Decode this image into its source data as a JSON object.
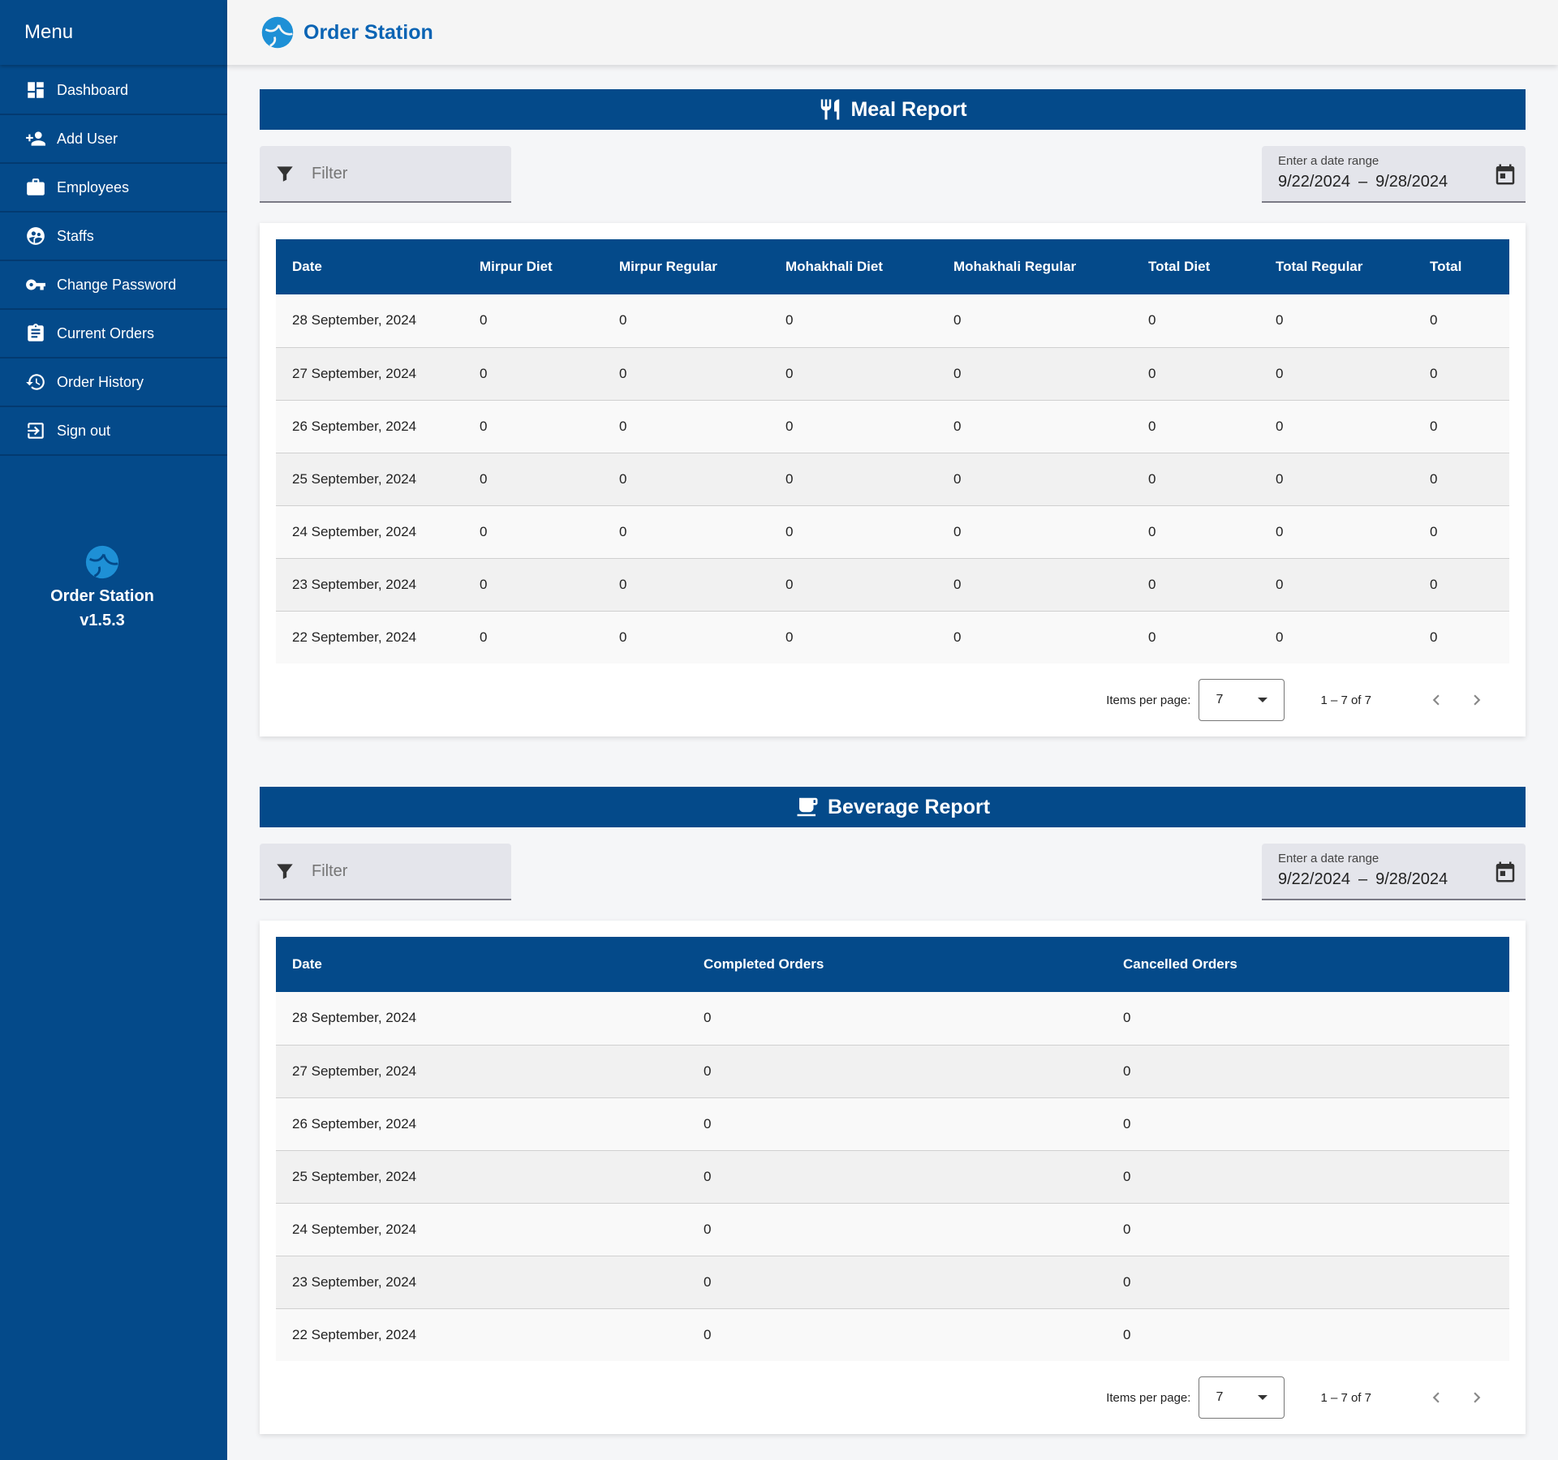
{
  "sidebar": {
    "title": "Menu",
    "items": [
      {
        "label": "Dashboard",
        "icon": "dashboard-icon"
      },
      {
        "label": "Add User",
        "icon": "add-user-icon"
      },
      {
        "label": "Employees",
        "icon": "briefcase-icon"
      },
      {
        "label": "Staffs",
        "icon": "staffs-icon"
      },
      {
        "label": "Change Password",
        "icon": "key-icon"
      },
      {
        "label": "Current Orders",
        "icon": "clipboard-icon"
      },
      {
        "label": "Order History",
        "icon": "history-icon"
      },
      {
        "label": "Sign out",
        "icon": "sign-out-icon"
      }
    ],
    "brand_name": "Order Station",
    "version": "v1.5.3"
  },
  "header": {
    "title": "Order Station"
  },
  "colors": {
    "primary": "#044a8a",
    "brand_text": "#0b64b4",
    "logo": "#1e90d6"
  },
  "meal_report": {
    "title": "Meal Report",
    "icon": "utensils-icon",
    "filter_placeholder": "Filter",
    "date_range_label": "Enter a date range",
    "date_start": "9/22/2024",
    "date_sep": "–",
    "date_end": "9/28/2024",
    "columns": [
      "Date",
      "Mirpur Diet",
      "Mirpur Regular",
      "Mohakhali Diet",
      "Mohakhali Regular",
      "Total Diet",
      "Total Regular",
      "Total"
    ],
    "rows": [
      [
        "28 September, 2024",
        "0",
        "0",
        "0",
        "0",
        "0",
        "0",
        "0"
      ],
      [
        "27 September, 2024",
        "0",
        "0",
        "0",
        "0",
        "0",
        "0",
        "0"
      ],
      [
        "26 September, 2024",
        "0",
        "0",
        "0",
        "0",
        "0",
        "0",
        "0"
      ],
      [
        "25 September, 2024",
        "0",
        "0",
        "0",
        "0",
        "0",
        "0",
        "0"
      ],
      [
        "24 September, 2024",
        "0",
        "0",
        "0",
        "0",
        "0",
        "0",
        "0"
      ],
      [
        "23 September, 2024",
        "0",
        "0",
        "0",
        "0",
        "0",
        "0",
        "0"
      ],
      [
        "22 September, 2024",
        "0",
        "0",
        "0",
        "0",
        "0",
        "0",
        "0"
      ]
    ],
    "items_per_page_label": "Items per page:",
    "items_per_page": "7",
    "range_label": "1 – 7 of 7"
  },
  "beverage_report": {
    "title": "Beverage Report",
    "icon": "coffee-cup-icon",
    "filter_placeholder": "Filter",
    "date_range_label": "Enter a date range",
    "date_start": "9/22/2024",
    "date_sep": "–",
    "date_end": "9/28/2024",
    "columns": [
      "Date",
      "Completed Orders",
      "Cancelled Orders"
    ],
    "rows": [
      [
        "28 September, 2024",
        "0",
        "0"
      ],
      [
        "27 September, 2024",
        "0",
        "0"
      ],
      [
        "26 September, 2024",
        "0",
        "0"
      ],
      [
        "25 September, 2024",
        "0",
        "0"
      ],
      [
        "24 September, 2024",
        "0",
        "0"
      ],
      [
        "23 September, 2024",
        "0",
        "0"
      ],
      [
        "22 September, 2024",
        "0",
        "0"
      ]
    ],
    "items_per_page_label": "Items per page:",
    "items_per_page": "7",
    "range_label": "1 – 7 of 7"
  }
}
